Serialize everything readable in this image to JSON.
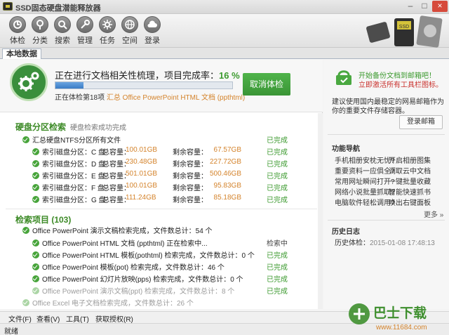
{
  "window": {
    "title": "SSD固态硬盘潜能释放器",
    "controls": [
      "–",
      "□",
      "×"
    ]
  },
  "toolbar": {
    "items": [
      {
        "label": "体检",
        "icon": "checkup-icon"
      },
      {
        "label": "分类",
        "icon": "pin-icon"
      },
      {
        "label": "搜索",
        "icon": "search-icon"
      },
      {
        "label": "管理",
        "icon": "tools-icon"
      },
      {
        "label": "任务",
        "icon": "gear-icon"
      },
      {
        "label": "空间",
        "icon": "globe-icon"
      },
      {
        "label": "登录",
        "icon": "cloud-icon"
      }
    ],
    "art_text": "SSD"
  },
  "tabs": {
    "local": "本地数据"
  },
  "progress": {
    "title_prefix": "正在进行文档相关性梳理，项目完成率：",
    "percent_text": "16 %",
    "percent": 16,
    "sub_prefix": "正在体检第18项",
    "sub_file": "汇总 Office PowerPoint HTML 文档 (ppthtml)",
    "cancel": "取消体检"
  },
  "partition": {
    "title": "硬盘分区检索",
    "subtitle": "硬盘检索成功完成",
    "summary": {
      "label": "汇总硬盘NTFS分区所有文件",
      "status": "已完成"
    },
    "rows": [
      {
        "name": "索引磁盘分区：C 盘",
        "total_label": "总容量：",
        "total": "100.01GB",
        "free_label": "剩余容量：",
        "free": "67.57GB",
        "status": "已完成"
      },
      {
        "name": "索引磁盘分区：D 盘",
        "total_label": "总容量：",
        "total": "230.48GB",
        "free_label": "剩余容量：",
        "free": "227.72GB",
        "status": "已完成"
      },
      {
        "name": "索引磁盘分区：E 盘",
        "total_label": "总容量：",
        "total": "501.01GB",
        "free_label": "剩余容量：",
        "free": "500.46GB",
        "status": "已完成"
      },
      {
        "name": "索引磁盘分区：F 盘",
        "total_label": "总容量：",
        "total": "100.01GB",
        "free_label": "剩余容量：",
        "free": "95.83GB",
        "status": "已完成"
      },
      {
        "name": "索引磁盘分区：G 盘",
        "total_label": "总容量：",
        "total": "111.24GB",
        "free_label": "剩余容量：",
        "free": "85.18GB",
        "status": "已完成"
      }
    ]
  },
  "search_items": {
    "title": "检索项目 (103)",
    "group": "Office PowerPoint 演示文稿检索完成，文件数总计：54 个",
    "rows": [
      {
        "text": "Office PowerPoint HTML 文档 (ppthtml) 正在检索中...",
        "status": "检索中"
      },
      {
        "text": "Office PowerPoint HTML 模板(pothtml) 检索完成，文件数总计：0 个",
        "status": "已完成"
      },
      {
        "text": "Office PowerPoint 模板(pot) 检索完成，文件数总计：46 个",
        "status": "已完成"
      },
      {
        "text": "Office PowerPoint 幻灯片放映(pps) 检索完成，文件数总计：0 个",
        "status": "已完成"
      },
      {
        "text": "Office PowerPoint 演示文稿(ppt) 检索完成，文件数总计：8 个",
        "status": "已完成"
      }
    ],
    "cut_row": "Office Excel 电子文档检索完成，文件数总计：26 个"
  },
  "sidebar": {
    "ad_line1": "开始备份文档到邮箱吧！",
    "ad_line2": "立即激活所有工具栏图标。",
    "desc": "建议使用国内最稳定的网易邮箱作为你的重要文件存储容器。",
    "login": "登录邮箱",
    "nav_title": "功能导航",
    "nav": [
      [
        "手机相册安枕无忧?",
        "开启相册图集"
      ],
      [
        "重要资料一应俱全?",
        "调取云中文档"
      ],
      [
        "常用网址瞬间打开?",
        "一键批量收藏"
      ],
      [
        "网络小说批量抓取?",
        "智能快速抓书"
      ],
      [
        "电脑软件轻松调用?",
        "唤出右键面板"
      ]
    ],
    "more": "更多 »",
    "history_title": "历史日志",
    "history_label": "历史体检：",
    "history_time": "2015-01-08 17:48:13"
  },
  "menu": [
    "文件(F)",
    "查看(V)",
    "工具(T)",
    "获取授权(R)"
  ],
  "status": "就绪",
  "watermark": {
    "brand": "巴士下载",
    "url": "www.11684.com"
  },
  "colors": {
    "accent_green": "#3c9a2f",
    "orange": "#d4832b",
    "red": "#c9302c",
    "bar": "#3a7cc6"
  }
}
